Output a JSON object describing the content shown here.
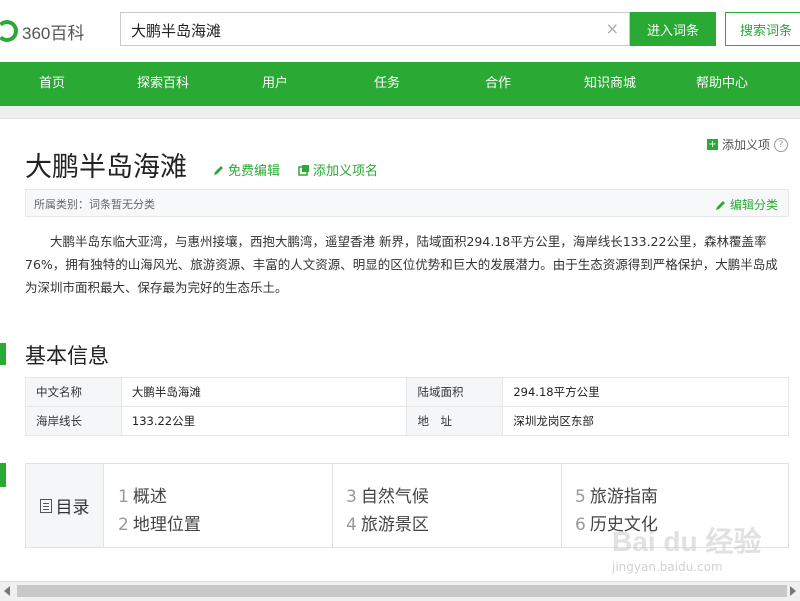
{
  "header": {
    "logo_text": "360百科",
    "search_value": "大鹏半岛海滩",
    "clear_icon": "×",
    "enter_button": "进入词条",
    "search_button": "搜索词条"
  },
  "nav": {
    "items": [
      "首页",
      "探索百科",
      "用户",
      "任务",
      "合作",
      "知识商城",
      "帮助中心"
    ]
  },
  "entry": {
    "title": "大鹏半岛海滩",
    "free_edit": "免费编辑",
    "add_meaning": "添加义项名",
    "add_definition": "添加义项",
    "help_icon": "?",
    "category_label": "所属类别：词条暂无分类",
    "edit_category": "编辑分类",
    "summary": "大鹏半岛东临大亚湾，与惠州接壤，西抱大鹏湾，遥望香港 新界，陆域面积294.18平方公里，海岸线长133.22公里，森林覆盖率76%，拥有独特的山海风光、旅游资源、丰富的人文资源、明显的区位优势和巨大的发展潜力。由于生态资源得到严格保护，大鹏半岛成为深圳市面积最大、保存最为完好的生态乐土。"
  },
  "basic_info": {
    "heading": "基本信息",
    "rows": [
      {
        "k1": "中文名称",
        "v1": "大鹏半岛海滩",
        "k2": "陆域面积",
        "v2": "294.18平方公里"
      },
      {
        "k1": "海岸线长",
        "v1": "133.22公里",
        "k2": "地　址",
        "v2": "深圳龙岗区东部"
      }
    ]
  },
  "catalog": {
    "heading": "目录",
    "items": [
      {
        "num": "1",
        "label": "概述"
      },
      {
        "num": "2",
        "label": "地理位置"
      },
      {
        "num": "3",
        "label": "自然气候"
      },
      {
        "num": "4",
        "label": "旅游景区"
      },
      {
        "num": "5",
        "label": "旅游指南"
      },
      {
        "num": "6",
        "label": "历史文化"
      }
    ]
  },
  "watermark": {
    "text": "Bai du 经验",
    "url": "jingyan.baidu.com"
  },
  "colors": {
    "brand_green": "#2aaa35",
    "nav_text": "#ffffff"
  },
  "icons": [
    "logo-ring-icon",
    "clear-icon",
    "pen-icon",
    "add-meaning-icon",
    "plus-box-icon",
    "help-icon",
    "list-icon"
  ]
}
